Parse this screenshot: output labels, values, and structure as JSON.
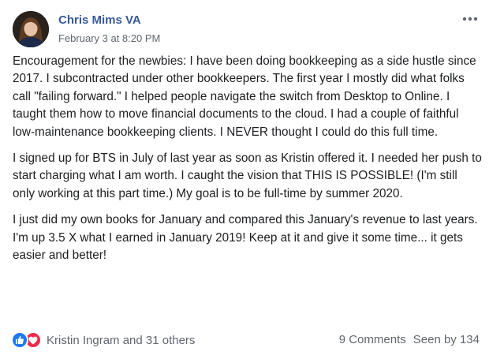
{
  "post": {
    "author": "Chris Mims VA",
    "timestamp": "February 3 at 8:20 PM",
    "more_icon": "more-horizontal-icon",
    "paragraphs": [
      "Encouragement for the newbies: I have been doing bookkeeping as a side hustle since 2017. I subcontracted under other bookkeepers. The first year I mostly did what folks call \"failing forward.\" I helped people navigate the switch from Desktop to Online. I taught them how to move financial documents to the cloud. I had a couple of faithful low-maintenance bookkeeping clients. I NEVER thought I could do this full time.",
      "I signed up for BTS in July of last year as soon as Kristin offered it. I needed her push to start charging what I am worth. I caught the vision that THIS IS POSSIBLE! (I'm still only working at this part time.) My goal is to be full-time by summer 2020.",
      "I just did my own books for January and compared this January's revenue to last years. I'm up 3.5 X what I earned in January 2019! Keep at it and give it some time... it gets easier and better!"
    ]
  },
  "footer": {
    "reaction_icons": [
      "like-icon",
      "love-icon"
    ],
    "reactions_text": "Kristin Ingram and 31 others",
    "comments": "9 Comments",
    "seen": "Seen by 134"
  },
  "colors": {
    "author_link": "#385898",
    "secondary_text": "#606770",
    "like_blue": "#2078f4",
    "love_red": "#f0284a"
  }
}
